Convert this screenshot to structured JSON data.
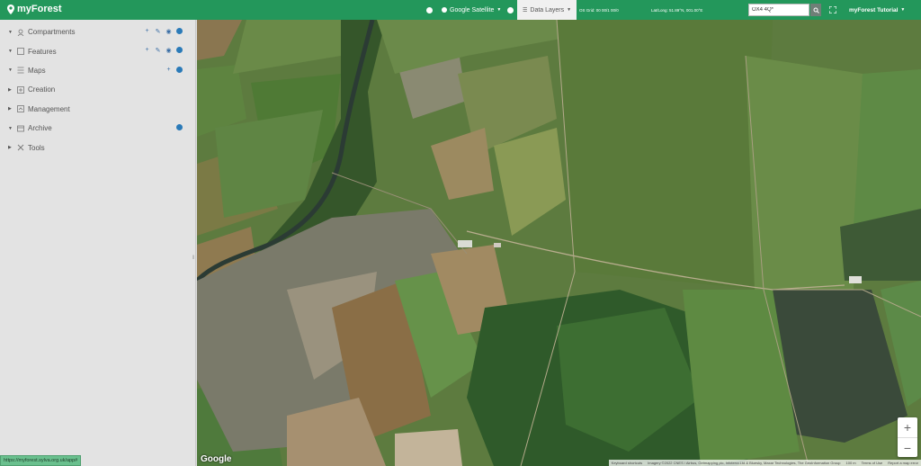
{
  "app": {
    "brand": "myForest"
  },
  "topbar": {
    "basemap_label": "Google Satellite",
    "data_layers_label": "Data Layers",
    "coords_1": "OS Grid: 00 00/1 00/0",
    "coords_2": "Lat/Long: 51.89°N, 001.00°E",
    "search_value": "OX4 4Q*",
    "user_label": "myForest Tutorial"
  },
  "sidebar": {
    "items": [
      {
        "label": "Compartments",
        "icon": "compartments-icon",
        "actions": [
          "add",
          "edit",
          "view",
          "info"
        ]
      },
      {
        "label": "Features",
        "icon": "features-icon",
        "actions": [
          "add",
          "edit",
          "view",
          "info"
        ]
      },
      {
        "label": "Maps",
        "icon": "maps-icon",
        "actions": [
          "add",
          "info"
        ]
      },
      {
        "label": "Creation",
        "icon": "creation-icon",
        "actions": []
      },
      {
        "label": "Management",
        "icon": "management-icon",
        "actions": []
      },
      {
        "label": "Archive",
        "icon": "archive-icon",
        "actions": [
          "info"
        ]
      },
      {
        "label": "Tools",
        "icon": "tools-icon",
        "actions": []
      }
    ],
    "status_url": "https://myforest.sylva.org.uk/app#"
  },
  "map": {
    "provider_logo": "Google",
    "attribution": [
      "Keyboard shortcuts",
      "Imagery ©2022 CNES / Airbus, Getmapping plc, Infoterra Ltd & Bluesky, Maxar Technologies, The GeoInformation Group",
      "100 m",
      "Terms of Use",
      "Report a map error"
    ],
    "zoom_in": "+",
    "zoom_out": "−"
  },
  "colors": {
    "brand_green": "#23975b",
    "sidebar_bg": "#e3e3e3",
    "action_blue": "#2a7ab8"
  }
}
